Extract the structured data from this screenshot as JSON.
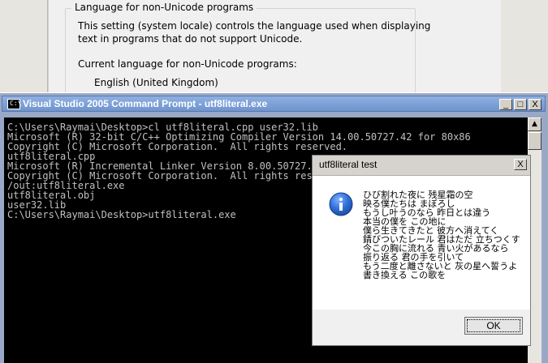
{
  "background_dialog": {
    "group_title": "Language for non-Unicode programs",
    "description_line1": "This setting (system locale) controls the language used when displaying",
    "description_line2": "text in programs that do not support Unicode.",
    "current_label": "Current language for non-Unicode programs:",
    "current_value": "English (United Kingdom)"
  },
  "console": {
    "title": "Visual Studio 2005 Command Prompt - utf8literal.exe",
    "buttons": {
      "minimize": "_",
      "maximize": "□",
      "close": "X"
    },
    "lines": [
      "",
      "C:\\Users\\Raymai\\Desktop>cl utf8literal.cpp user32.lib",
      "Microsoft (R) 32-bit C/C++ Optimizing Compiler Version 14.00.50727.42 for 80x86",
      "Copyright (C) Microsoft Corporation.  All rights reserved.",
      "",
      "utf8literal.cpp",
      "Microsoft (R) Incremental Linker Version 8.00.50727.42",
      "Copyright (C) Microsoft Corporation.  All rights reserved.",
      "",
      "/out:utf8literal.exe",
      "utf8literal.obj",
      "user32.lib",
      "",
      "C:\\Users\\Raymai\\Desktop>utf8literal.exe"
    ],
    "scroll_up": "▲"
  },
  "message_box": {
    "title": "utf8literal test",
    "close": "X",
    "icon": "info-icon",
    "lines": [
      "ひび割れた夜に 残星霜の空",
      "映る僕たちは まぼろし",
      "もうし叶うのなら 昨日とは違う",
      "本当の僕を この地に",
      "僕ら生きてきたと 彼方へ消えてく",
      "錆びついたレール 君はただ 立ちつくす",
      "今この胸に流れる 青い火があるなら",
      "振り返る 君の手を引いて",
      "もう二度と離さないと 灰の星へ誓うよ",
      "書き換える この歌を"
    ],
    "ok_label": "OK"
  }
}
